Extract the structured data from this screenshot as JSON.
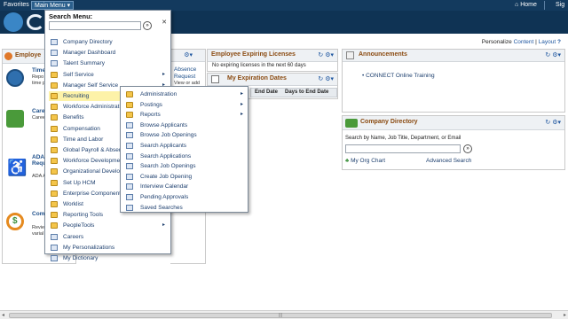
{
  "topbar": {
    "favorites": "Favorites",
    "main_menu": "Main Menu",
    "home": "Home",
    "signout": "Sig"
  },
  "personalize": {
    "prefix": "Personalize",
    "content": "Content",
    "sep": "|",
    "layout": "Layout"
  },
  "employee_pagelet": {
    "title": "Employe",
    "tiles": [
      {
        "title": "Time",
        "text": "Repo time a Repo time p",
        "icon": "person-clock-icon"
      },
      {
        "title": "Care",
        "text": "Caree jobs a track",
        "icon": "career-gears-icon"
      },
      {
        "title": "ADA Acco Requ",
        "text": "ADA Acco Requ",
        "icon": "wheelchair-icon"
      },
      {
        "title": "Com Histo",
        "text": "Revie comp histor varial option",
        "icon": "dollar-cycle-icon"
      }
    ]
  },
  "absence_pagelet": {
    "line1": "Absence",
    "line2": "Request",
    "line3": "View or add"
  },
  "expiring": {
    "title": "Employee Expiring Licenses",
    "message": "No expiring licenses in the next 60 days"
  },
  "expiration_dates": {
    "title": "My Expiration Dates",
    "col1": "End Date",
    "col2": "Days to End Date"
  },
  "announcements": {
    "title": "Announcements",
    "items": [
      "CONNECT Online Training"
    ]
  },
  "company_directory": {
    "title": "Company Directory",
    "prompt": "Search by Name, Job Title, Department, or Email",
    "org_chart": "My Org Chart",
    "advanced": "Advanced Search"
  },
  "menu": {
    "title": "Search Menu:",
    "items": [
      {
        "label": "Company Directory",
        "type": "doc"
      },
      {
        "label": "Manager Dashboard",
        "type": "doc"
      },
      {
        "label": "Talent Summary",
        "type": "doc"
      },
      {
        "label": "Self Service",
        "type": "folder",
        "arrow": true
      },
      {
        "label": "Manager Self Service",
        "type": "folder",
        "arrow": true
      },
      {
        "label": "Recruiting",
        "type": "folder",
        "arrow": true,
        "active": true
      },
      {
        "label": "Workforce Administrati",
        "type": "folder"
      },
      {
        "label": "Benefits",
        "type": "folder"
      },
      {
        "label": "Compensation",
        "type": "folder"
      },
      {
        "label": "Time and Labor",
        "type": "folder"
      },
      {
        "label": "Global Payroll & Absenc",
        "type": "folder"
      },
      {
        "label": "Workforce Developmen",
        "type": "folder"
      },
      {
        "label": "Organizational Develop",
        "type": "folder"
      },
      {
        "label": "Set Up HCM",
        "type": "folder"
      },
      {
        "label": "Enterprise Components",
        "type": "folder"
      },
      {
        "label": "Worklist",
        "type": "folder"
      },
      {
        "label": "Reporting Tools",
        "type": "folder"
      },
      {
        "label": "PeopleTools",
        "type": "folder",
        "arrow": true
      },
      {
        "label": "Careers",
        "type": "doc"
      },
      {
        "label": "My Personalizations",
        "type": "doc"
      },
      {
        "label": "My Dictionary",
        "type": "doc"
      }
    ]
  },
  "submenu": {
    "items": [
      {
        "label": "Administration",
        "type": "folder",
        "arrow": true
      },
      {
        "label": "Postings",
        "type": "folder",
        "arrow": true
      },
      {
        "label": "Reports",
        "type": "folder",
        "arrow": true
      },
      {
        "label": "Browse Applicants",
        "type": "doc"
      },
      {
        "label": "Browse Job Openings",
        "type": "doc"
      },
      {
        "label": "Search Applicants",
        "type": "doc"
      },
      {
        "label": "Search Applications",
        "type": "doc"
      },
      {
        "label": "Search Job Openings",
        "type": "doc"
      },
      {
        "label": "Create Job Opening",
        "type": "doc"
      },
      {
        "label": "Interview Calendar",
        "type": "doc"
      },
      {
        "label": "Pending Approvals",
        "type": "doc"
      },
      {
        "label": "Saved Searches",
        "type": "doc"
      }
    ]
  },
  "colors": {
    "topbar": "#133a5e",
    "accent_orange": "#8a4a10",
    "link_blue": "#1f57a0",
    "menu_highlight": "#fdf2a8"
  }
}
